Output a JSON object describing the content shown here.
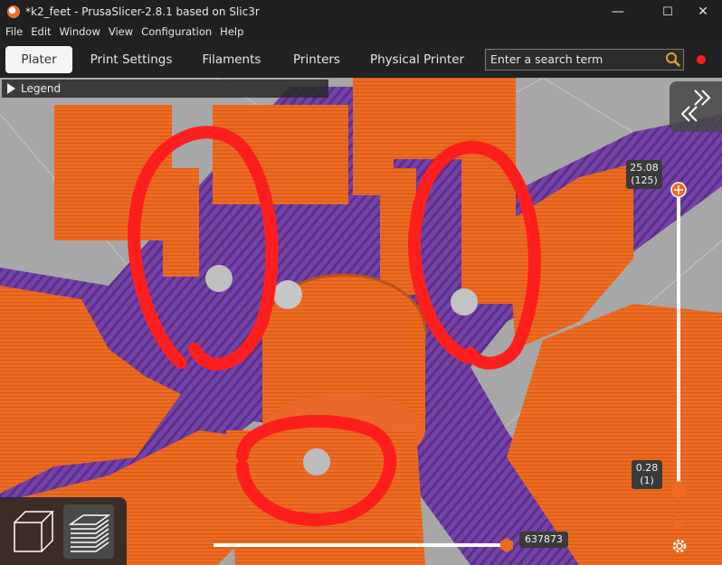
{
  "window": {
    "title": "*k2_feet - PrusaSlicer-2.8.1 based on Slic3r",
    "controls": [
      "—",
      "☐",
      "✕"
    ]
  },
  "menu": [
    "File",
    "Edit",
    "Window",
    "View",
    "Configuration",
    "Help"
  ],
  "tabs": [
    "Plater",
    "Print Settings",
    "Filaments",
    "Printers",
    "Physical Printer"
  ],
  "search": {
    "placeholder": "Enter a search term"
  },
  "legend": {
    "label": "Legend"
  },
  "layer_slider": {
    "top_value": "25.08",
    "top_layer": "(125)",
    "bottom_value": "0.28",
    "bottom_layer": "(1)"
  },
  "move_slider": {
    "value": "637873"
  },
  "colors": {
    "accent": "#ed6b21",
    "support": "#6e3fa0",
    "annotation": "#ff1e1e"
  },
  "icons": [
    "search-icon",
    "record-indicator-icon",
    "collapse-sidebar-icon",
    "add-color-change-icon",
    "lock-icon",
    "settings-cog-icon",
    "3d-view-icon",
    "preview-layers-icon"
  ]
}
